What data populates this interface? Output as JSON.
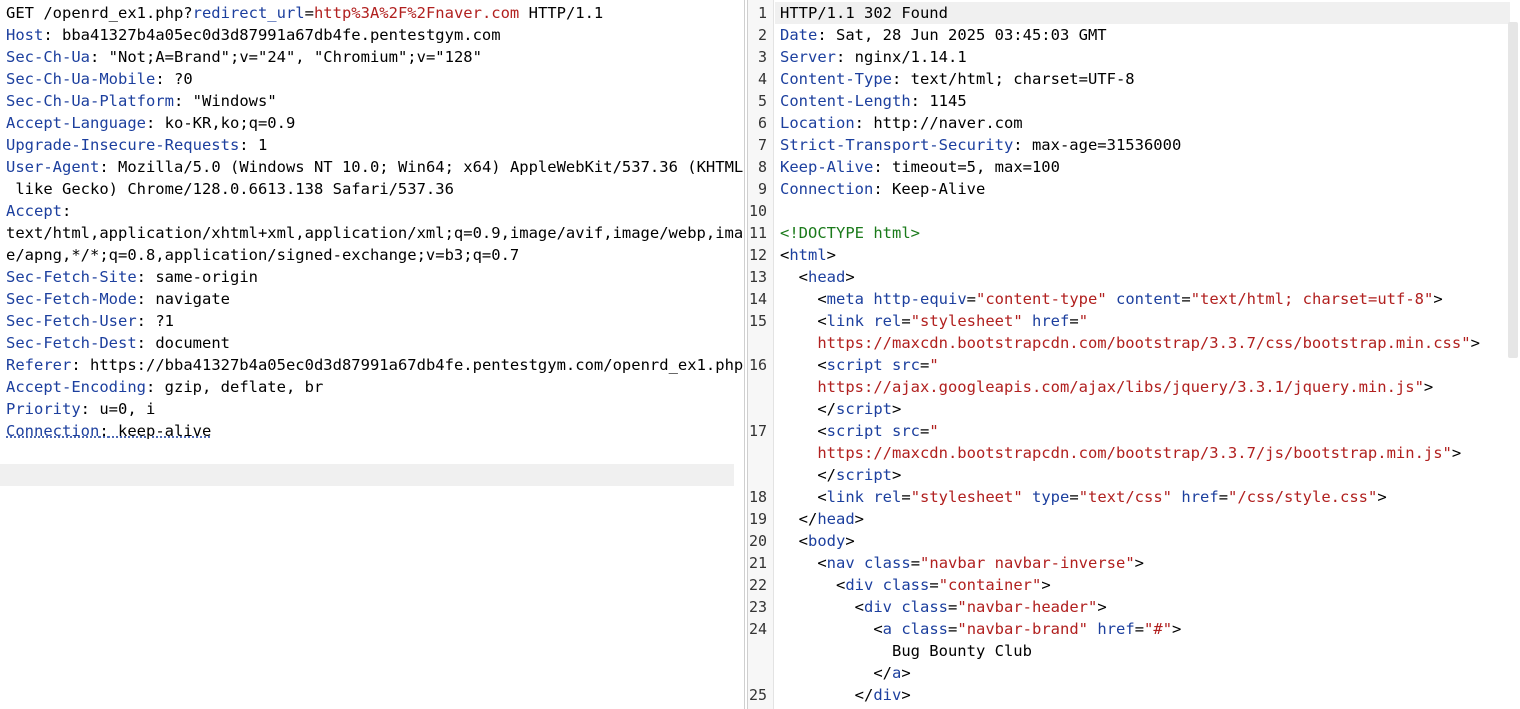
{
  "request": {
    "line1": {
      "method_path": "GET /openrd_ex1.php?",
      "param": "redirect_url",
      "eq": "=",
      "value": "http%3A%2F%2Fnaver.com",
      "proto": " HTTP/1.1"
    },
    "headers": [
      {
        "name": "Host",
        "value": " bba41327b4a05ec0d3d87991a67db4fe.pentestgym.com"
      },
      {
        "name": "Sec-Ch-Ua",
        "value": " \"Not;A=Brand\";v=\"24\", \"Chromium\";v=\"128\""
      },
      {
        "name": "Sec-Ch-Ua-Mobile",
        "value": " ?0"
      },
      {
        "name": "Sec-Ch-Ua-Platform",
        "value": " \"Windows\""
      },
      {
        "name": "Accept-Language",
        "value": " ko-KR,ko;q=0.9"
      },
      {
        "name": "Upgrade-Insecure-Requests",
        "value": " 1"
      },
      {
        "name": "User-Agent",
        "value": " Mozilla/5.0 (Windows NT 10.0; Win64; x64) AppleWebKit/537.36 (KHTML,"
      }
    ],
    "ua_cont": " like Gecko) Chrome/128.0.6613.138 Safari/537.36",
    "accept_name": "Accept",
    "accept_lines": [
      "text/html,application/xhtml+xml,application/xml;q=0.9,image/avif,image/webp,imag",
      "e/apng,*/*;q=0.8,application/signed-exchange;v=b3;q=0.7"
    ],
    "headers2": [
      {
        "name": "Sec-Fetch-Site",
        "value": " same-origin"
      },
      {
        "name": "Sec-Fetch-Mode",
        "value": " navigate"
      },
      {
        "name": "Sec-Fetch-User",
        "value": " ?1"
      },
      {
        "name": "Sec-Fetch-Dest",
        "value": " document"
      },
      {
        "name": "Referer",
        "value": " https://bba41327b4a05ec0d3d87991a67db4fe.pentestgym.com/openrd_ex1.php"
      },
      {
        "name": "Accept-Encoding",
        "value": " gzip, deflate, br"
      },
      {
        "name": "Priority",
        "value": " u=0, i"
      },
      {
        "name": "Connection",
        "value": " keep-alive"
      }
    ]
  },
  "response": {
    "line_numbers": [
      "1",
      "2",
      "3",
      "4",
      "5",
      "6",
      "7",
      "8",
      "9",
      "10",
      "11",
      "12",
      "13",
      "14",
      "15",
      "",
      "16",
      "",
      "",
      "17",
      "",
      "",
      "18",
      "19",
      "20",
      "21",
      "22",
      "23",
      "24",
      "",
      "",
      "25"
    ],
    "status": "HTTP/1.1 302 Found",
    "headers": [
      {
        "name": "Date",
        "value": " Sat, 28 Jun 2025 03:45:03 GMT"
      },
      {
        "name": "Server",
        "value": " nginx/1.14.1"
      },
      {
        "name": "Content-Type",
        "value": " text/html; charset=UTF-8"
      },
      {
        "name": "Content-Length",
        "value": " 1145"
      },
      {
        "name": "Location",
        "value": " http://naver.com"
      },
      {
        "name": "Strict-Transport-Security",
        "value": " max-age=31536000"
      },
      {
        "name": "Keep-Alive",
        "value": " timeout=5, max=100"
      },
      {
        "name": "Connection",
        "value": " Keep-Alive"
      }
    ],
    "body": {
      "doctype": "<!DOCTYPE html>",
      "html_open": "html",
      "head_open": "head",
      "meta_equiv_val": "\"content-type\"",
      "meta_content_val": "\"text/html; charset=utf-8\"",
      "link1_rel_val": "\"stylesheet\"",
      "link1_href_open": "\"",
      "link1_href_url": "https://maxcdn.bootstrapcdn.com/bootstrap/3.3.7/css/bootstrap.min.css\"",
      "script1_src_open": "\"",
      "script1_url": "https://ajax.googleapis.com/ajax/libs/jquery/3.3.1/jquery.min.js\"",
      "script2_url": "https://maxcdn.bootstrapcdn.com/bootstrap/3.3.7/js/bootstrap.min.js\"",
      "link2_rel_val": "\"stylesheet\"",
      "link2_type_val": "\"text/css\"",
      "link2_href_val": "\"/css/style.css\"",
      "nav_class_val": "\"navbar navbar-inverse\"",
      "div_container_val": "\"container\"",
      "div_header_val": "\"navbar-header\"",
      "a_class_val": "\"navbar-brand\"",
      "a_href_val": "\"#\"",
      "brand_text": "Bug Bounty Club"
    }
  }
}
